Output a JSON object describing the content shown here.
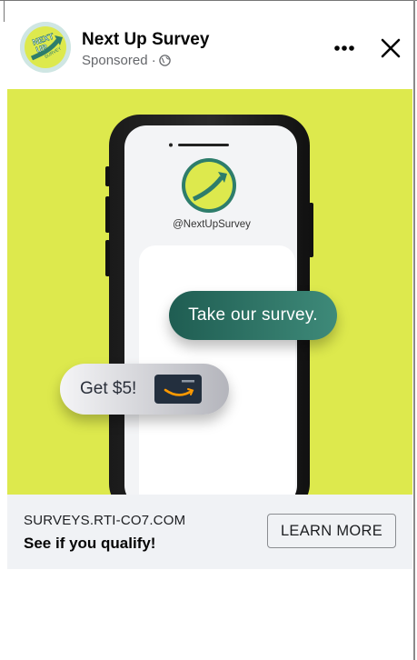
{
  "colors": {
    "background_lime": "#dde94d",
    "bubble_green": "#2f7567",
    "footer_bg": "#f0f2f5"
  },
  "header": {
    "page_name": "Next Up Survey",
    "sponsored_label": "Sponsored ·",
    "logo_text": "NEXT UP SURVEY",
    "more_icon": "more-horizontal-icon",
    "close_icon": "close-icon",
    "privacy_icon": "globe-icon"
  },
  "media": {
    "phone_handle": "@NextUpSurvey",
    "bubble_survey": "Take our survey.",
    "bubble_reward": "Get $5!",
    "gift_card_icon": "amazon-gift-card-icon"
  },
  "footer": {
    "domain": "SURVEYS.RTI-CO7.COM",
    "headline": "See if you qualify!",
    "cta_label": "LEARN MORE"
  }
}
